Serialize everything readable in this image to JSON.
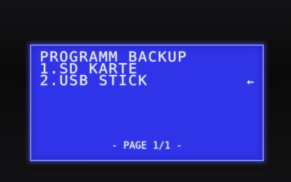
{
  "screen": {
    "title": "PROGRAMM BACKUP",
    "menu_items": [
      {
        "label": "1.SD KARTE",
        "selected": false
      },
      {
        "label": "2.USB STICK",
        "selected": true
      }
    ],
    "selection_marker": "←",
    "page_indicator": "- PAGE 1/1 -"
  },
  "colors": {
    "lcd_background": "#2f34e8",
    "lcd_text": "#e8eaff",
    "bezel": "#0b0b0c"
  }
}
